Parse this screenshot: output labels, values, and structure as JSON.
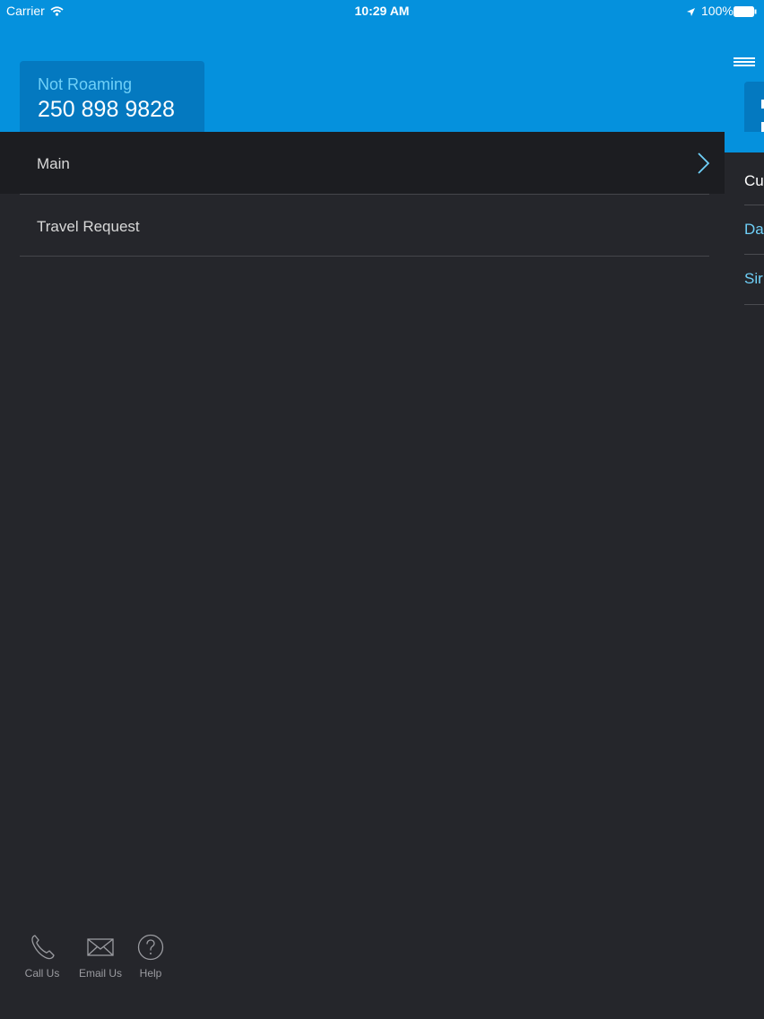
{
  "status_bar": {
    "carrier": "Carrier",
    "time": "10:29 AM",
    "battery": "100%"
  },
  "account": {
    "roaming_status": "Not Roaming",
    "phone_number": "250 898 9828"
  },
  "menu": {
    "items": [
      {
        "label": "Main",
        "active": true
      },
      {
        "label": "Travel Request",
        "active": false
      }
    ]
  },
  "right_panel": {
    "items": [
      {
        "label": "Cu",
        "color": "#ffffff"
      },
      {
        "label": "Da",
        "color": "#6fd0f8"
      },
      {
        "label": "Sir",
        "color": "#6fd0f8"
      }
    ]
  },
  "footer": {
    "call_label": "Call Us",
    "email_label": "Email Us",
    "help_label": "Help"
  },
  "colors": {
    "header_blue": "#0591dd",
    "card_blue": "#0479c0",
    "accent_light_blue": "#6fd0f8",
    "background": "#25262b"
  }
}
